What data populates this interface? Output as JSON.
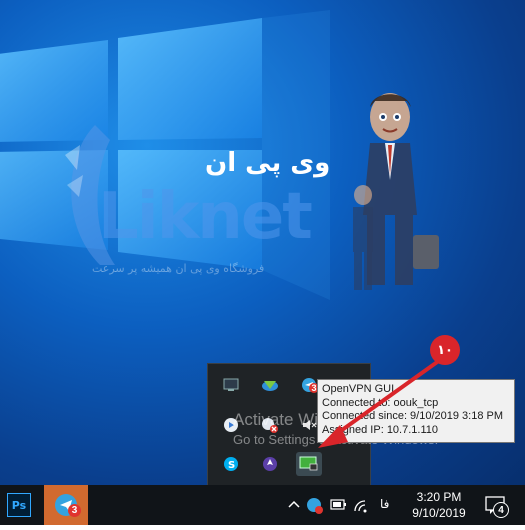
{
  "watermark": {
    "brand_fa": "وی پی ان",
    "brand_en": "Liknet",
    "tagline": "فروشگاه وی پی ان همیشه پر سرعت"
  },
  "callout": {
    "label": "۱۰"
  },
  "tooltip": {
    "line1": "OpenVPN GUI",
    "line2": "Connected to: oouk_tcp",
    "line3": "Connected since: 9/10/2019 3:18 PM",
    "line4": "Assigned IP: 10.7.1.110"
  },
  "activation": {
    "title": "Activate Windows",
    "subtitle": "Go to Settings to activate Windows."
  },
  "tray_popup": {
    "icons": [
      "monitor-icon",
      "internet-download-manager-icon",
      "telegram-icon",
      "app-icon",
      "speaker-muted-icon",
      "network-disconnected-icon",
      "skype-icon",
      "rocket-icon",
      "openvpn-icon"
    ],
    "telegram_badge": "3"
  },
  "taskbar": {
    "apps": [
      {
        "name": "photoshop-icon",
        "label": "Ps"
      },
      {
        "name": "telegram-icon",
        "badge": "3"
      }
    ],
    "language": "فا",
    "time": "3:20 PM",
    "date": "9/10/2019",
    "notification_count": "4"
  },
  "colors": {
    "accent_red": "#d9252a",
    "taskbar_bg": "#101418",
    "telegram_active": "#d16a2f"
  }
}
